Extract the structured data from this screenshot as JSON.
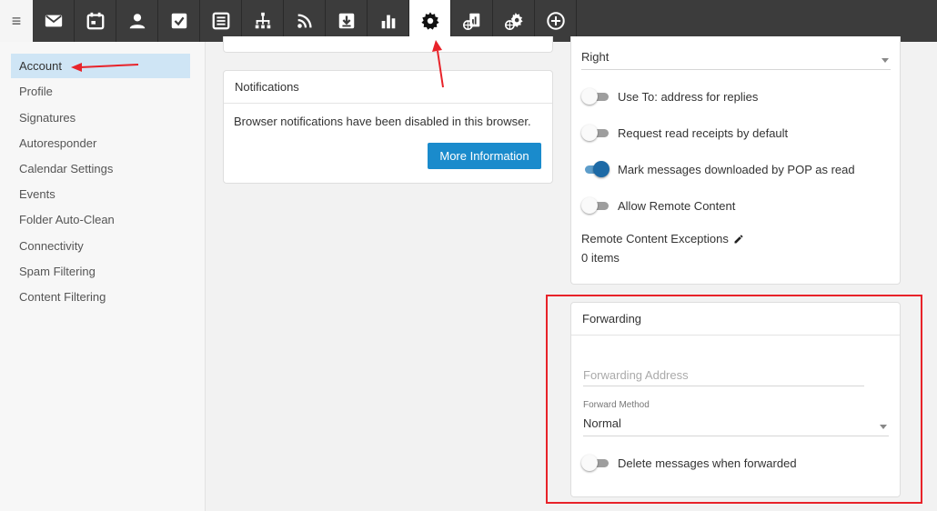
{
  "toolbar": {
    "menu_icon": "hamburger-icon",
    "active_index": 10,
    "icons": [
      {
        "name": "mail-icon"
      },
      {
        "name": "calendar-icon"
      },
      {
        "name": "contacts-icon"
      },
      {
        "name": "tasks-icon"
      },
      {
        "name": "notes-icon"
      },
      {
        "name": "sitemap-icon"
      },
      {
        "name": "rss-icon"
      },
      {
        "name": "download-icon"
      },
      {
        "name": "chart-icon"
      },
      {
        "name": "settings-gear-icon"
      },
      {
        "name": "domain-reports-icon"
      },
      {
        "name": "domain-settings-icon"
      },
      {
        "name": "add-circle-icon"
      }
    ]
  },
  "sidebar": {
    "items": [
      {
        "label": "Account",
        "selected": true
      },
      {
        "label": "Profile"
      },
      {
        "label": "Signatures"
      },
      {
        "label": "Autoresponder"
      },
      {
        "label": "Calendar Settings"
      },
      {
        "label": "Events"
      },
      {
        "label": "Folder Auto-Clean"
      },
      {
        "label": "Connectivity"
      },
      {
        "label": "Spam Filtering"
      },
      {
        "label": "Content Filtering"
      }
    ]
  },
  "notifications": {
    "title": "Notifications",
    "message": "Browser notifications have been disabled in this browser.",
    "button": "More Information"
  },
  "settings": {
    "position_value": "Right",
    "toggles": [
      {
        "label": "Use To: address for replies",
        "on": false
      },
      {
        "label": "Request read receipts by default",
        "on": false
      },
      {
        "label": "Mark messages downloaded by POP as read",
        "on": true
      },
      {
        "label": "Allow Remote Content",
        "on": false
      }
    ],
    "remote_exceptions_label": "Remote Content Exceptions",
    "remote_exceptions_count": "0 items"
  },
  "forwarding": {
    "title": "Forwarding",
    "address_placeholder": "Forwarding Address",
    "method_label": "Forward Method",
    "method_value": "Normal",
    "delete_label": "Delete messages when forwarded",
    "delete_on": false
  },
  "colors": {
    "accent": "#1a8bcc",
    "toolbar_bg": "#3c3c3c",
    "annotation": "#e8232a"
  }
}
